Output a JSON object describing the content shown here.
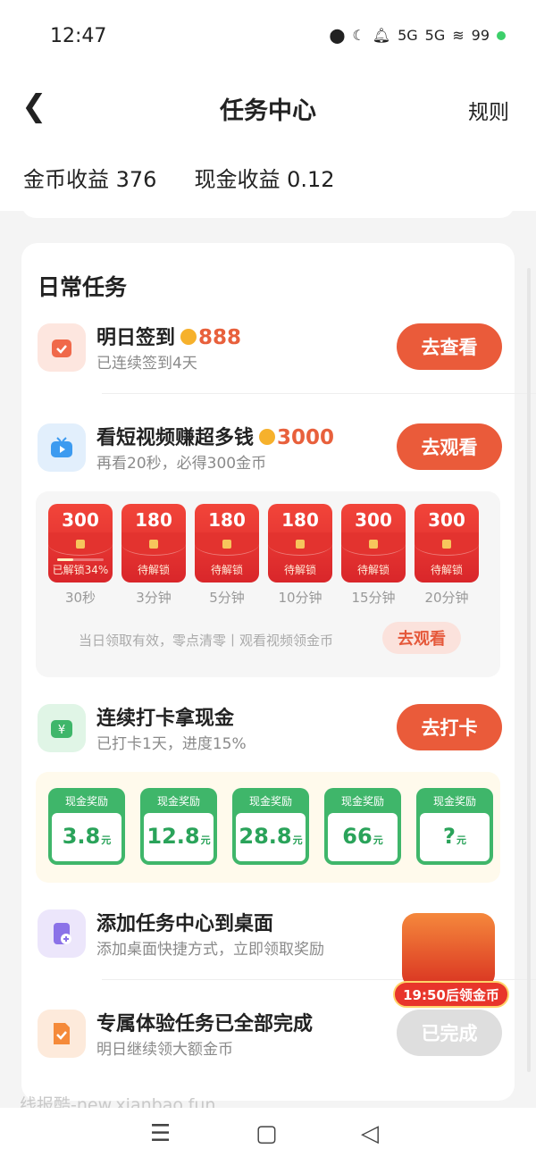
{
  "status": {
    "time": "12:47",
    "signal": "5G",
    "battery": "99"
  },
  "header": {
    "title": "任务中心",
    "rules": "规则"
  },
  "earnings": {
    "coin_label": "金币收益",
    "coin_value": "376",
    "cash_label": "现金收益",
    "cash_value": "0.12"
  },
  "daily": {
    "title": "日常任务",
    "tasks": [
      {
        "name": "明日签到",
        "reward": "888",
        "sub": "已连续签到4天",
        "button": "去查看"
      },
      {
        "name": "看短视频赚超多钱",
        "reward": "3000",
        "sub": "再看20秒，必得300金币",
        "button": "去观看"
      },
      {
        "name": "连续打卡拿现金",
        "sub": "已打卡1天，进度15%",
        "button": "去打卡"
      },
      {
        "name": "添加任务中心到桌面",
        "sub": "添加桌面快捷方式，立即领取奖励"
      },
      {
        "name": "专属体验任务已全部完成",
        "sub": "明日继续领大额金币",
        "button": "已完成"
      }
    ]
  },
  "video": {
    "envelopes": [
      {
        "amount": "300",
        "status": "已解锁34%",
        "time": "30秒",
        "progress": 0.34
      },
      {
        "amount": "180",
        "status": "待解锁",
        "time": "3分钟"
      },
      {
        "amount": "180",
        "status": "待解锁",
        "time": "5分钟"
      },
      {
        "amount": "180",
        "status": "待解锁",
        "time": "10分钟"
      },
      {
        "amount": "300",
        "status": "待解锁",
        "time": "15分钟"
      },
      {
        "amount": "300",
        "status": "待解锁",
        "time": "20分钟"
      }
    ],
    "note": "当日领取有效，零点清零丨观看视频领金币",
    "button": "去观看"
  },
  "cash": {
    "label": "现金奖励",
    "unit": "元",
    "values": [
      "3.8",
      "12.8",
      "28.8",
      "66",
      "?"
    ]
  },
  "chest": {
    "label": "19:50后领金币"
  },
  "watermark": "线报酷-new.xianbao.fun",
  "colors": {
    "accent": "#ea5b3a",
    "green": "#3fb66a",
    "coin": "#f6b12c"
  }
}
